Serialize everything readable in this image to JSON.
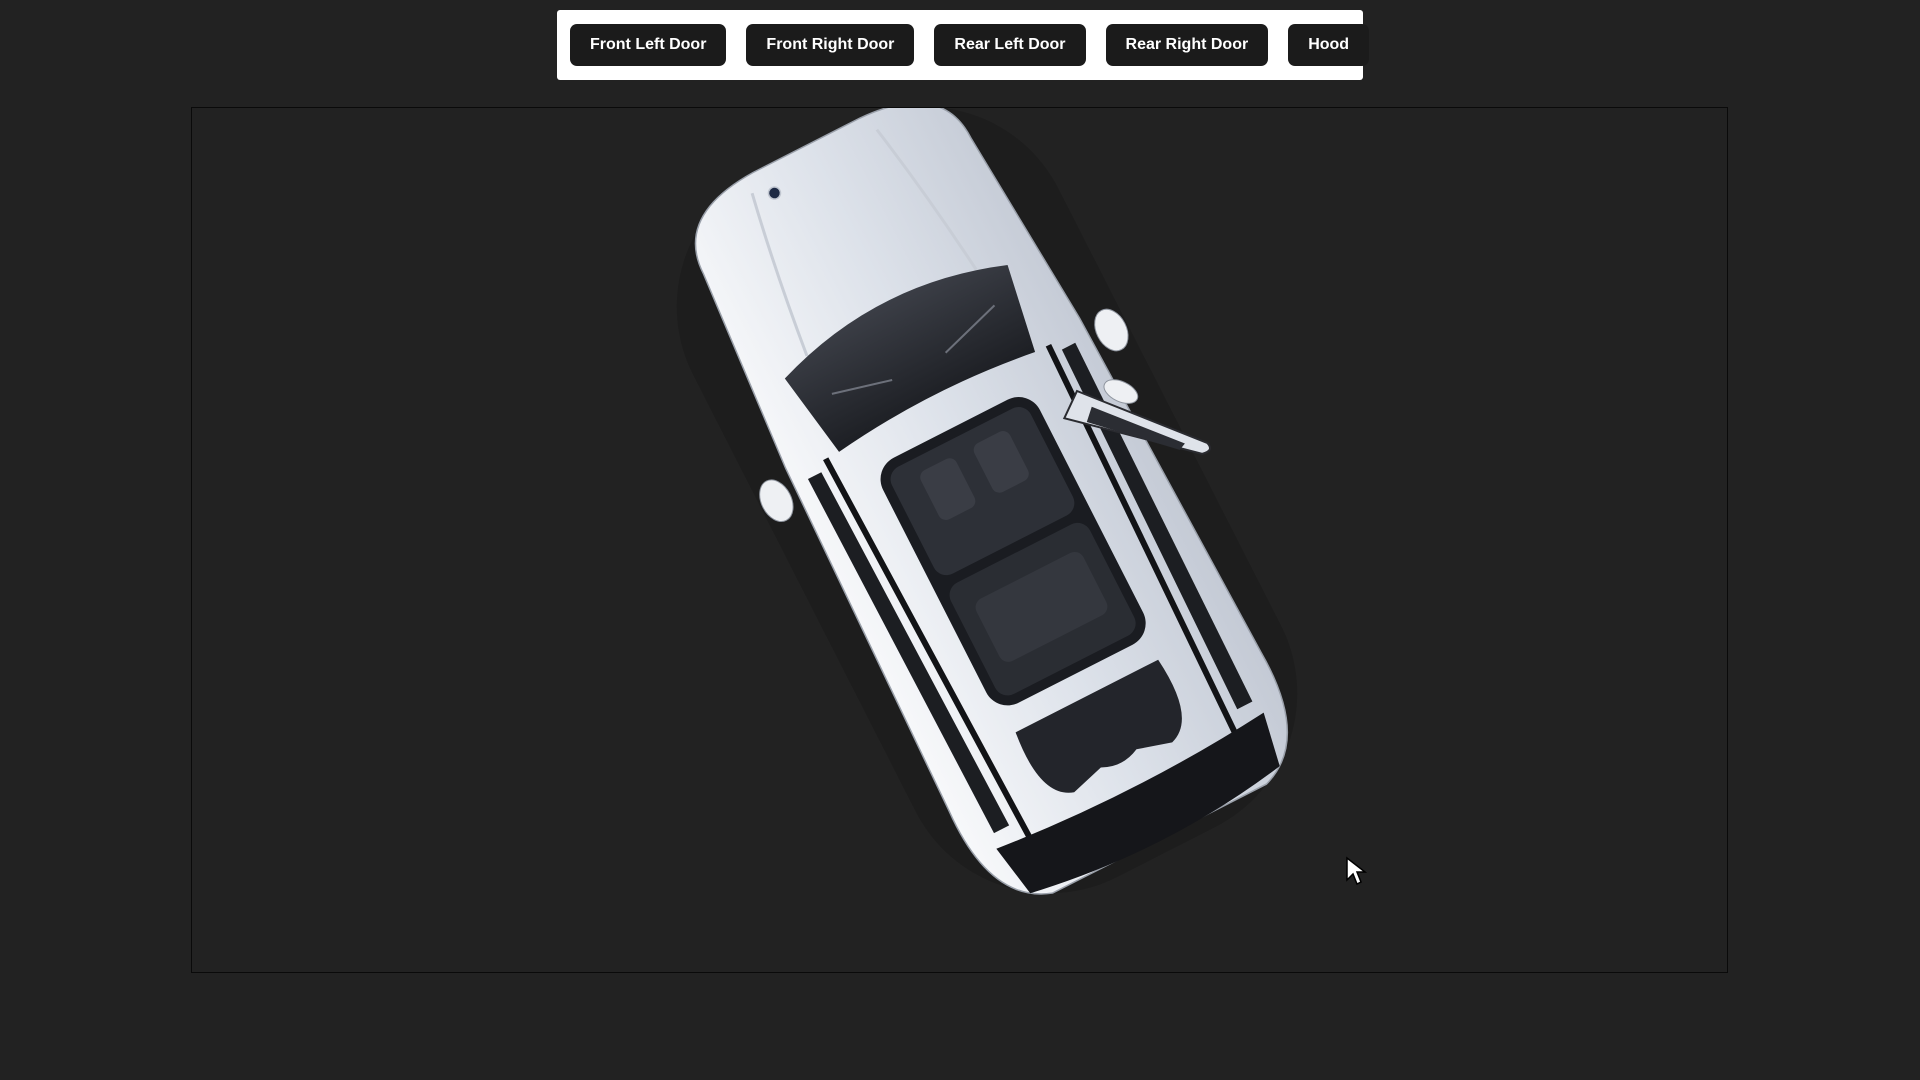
{
  "toolbar": {
    "buttons": [
      {
        "id": "front-left-door",
        "label": "Front Left Door"
      },
      {
        "id": "front-right-door",
        "label": "Front Right Door"
      },
      {
        "id": "rear-left-door",
        "label": "Rear Left Door"
      },
      {
        "id": "rear-right-door",
        "label": "Rear Right Door"
      },
      {
        "id": "hood",
        "label": "Hood"
      }
    ]
  },
  "viewer": {
    "model": "car-3d-model",
    "background_color": "#222222",
    "car_color": "#e6e9ef"
  }
}
